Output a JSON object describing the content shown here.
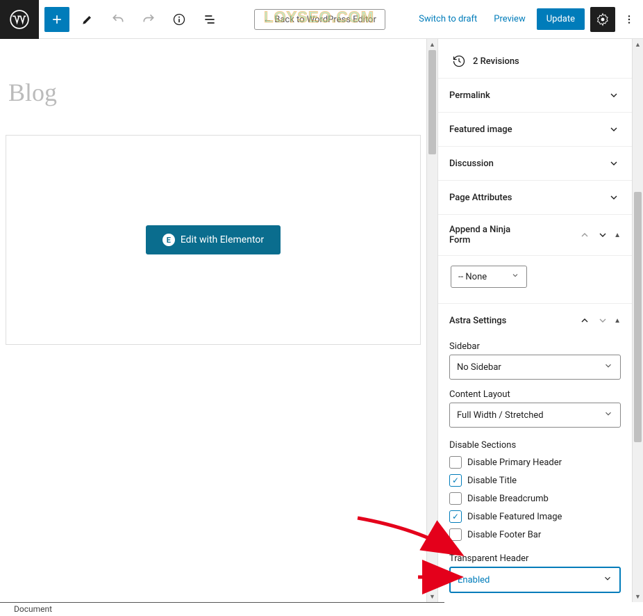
{
  "watermark": "LOYSEO.COM",
  "topbar": {
    "back_label": "← Back to WordPress Editor",
    "switch_draft": "Switch to draft",
    "preview": "Preview",
    "update": "Update"
  },
  "editor": {
    "title_placeholder": "Blog",
    "elementor_label": "Edit with Elementor"
  },
  "sidebar": {
    "revisions_count": "2 Revisions",
    "panels": {
      "permalink": "Permalink",
      "featured_image": "Featured image",
      "discussion": "Discussion",
      "page_attributes": "Page Attributes",
      "append_ninja": "Append a Ninja Form",
      "astra": "Astra Settings"
    },
    "ninja_select": "-- None",
    "astra": {
      "sidebar_label": "Sidebar",
      "sidebar_value": "No Sidebar",
      "content_layout_label": "Content Layout",
      "content_layout_value": "Full Width / Stretched",
      "disable_sections_label": "Disable Sections",
      "checks": [
        {
          "label": "Disable Primary Header",
          "checked": false
        },
        {
          "label": "Disable Title",
          "checked": true
        },
        {
          "label": "Disable Breadcrumb",
          "checked": false
        },
        {
          "label": "Disable Featured Image",
          "checked": true
        },
        {
          "label": "Disable Footer Bar",
          "checked": false
        }
      ],
      "transparent_header_label": "Transparent Header",
      "transparent_header_value": "Enabled"
    }
  },
  "footer": {
    "document_label": "Document"
  }
}
